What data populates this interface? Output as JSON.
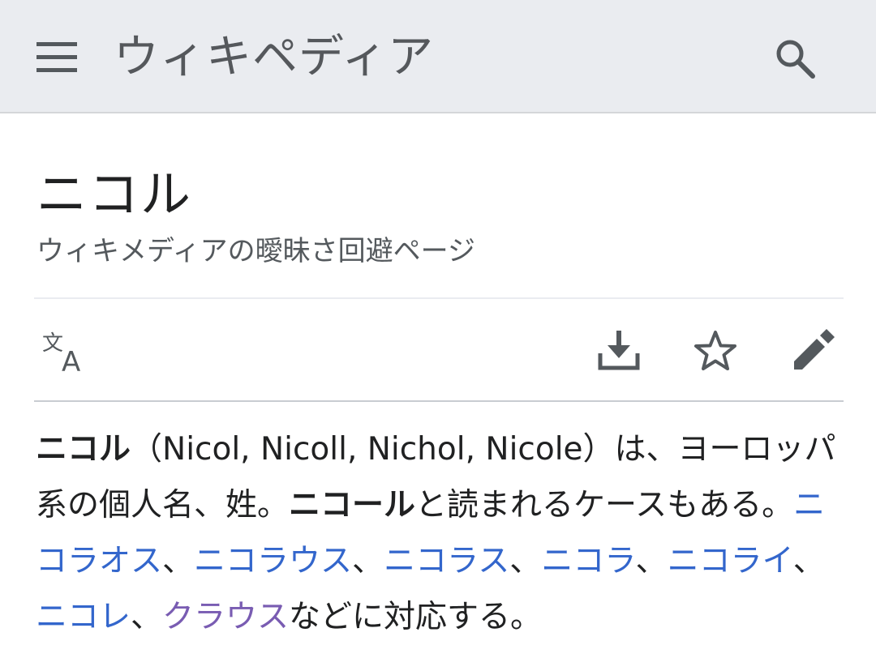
{
  "header": {
    "brand": "ウィキペディア",
    "icons": {
      "menu": "menu-icon",
      "search": "search-icon"
    }
  },
  "article": {
    "title": "ニコル",
    "subtitle": "ウィキメディアの曖昧さ回避ページ"
  },
  "toolbar": {
    "icons": [
      "language-icon",
      "download-icon",
      "star-icon",
      "edit-icon"
    ]
  },
  "body": {
    "term": "ニコル",
    "seg1": "（Nicol, Nicoll, Nichol, Nicole）は、ヨーロッパ系の個人名、姓。",
    "term2": "ニコール",
    "seg2": "と読まれるケースもある。",
    "links": [
      {
        "text": "ニコラオス",
        "color": "#3366cc"
      },
      {
        "text": "ニコラウス",
        "color": "#3366cc"
      },
      {
        "text": "ニコラス",
        "color": "#3366cc"
      },
      {
        "text": "ニコラ",
        "color": "#3366cc"
      },
      {
        "text": "ニコライ",
        "color": "#3366cc"
      },
      {
        "text": "ニコレ",
        "color": "#3366cc"
      },
      {
        "text": "クラウス",
        "color": "#795cb2"
      }
    ],
    "sep": "、",
    "tail": "などに対応する。"
  },
  "colors": {
    "link": "#3366cc",
    "visited_link": "#795cb2",
    "header_bg": "#eaecf0"
  }
}
